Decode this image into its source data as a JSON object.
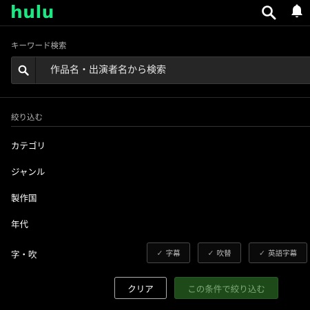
{
  "header": {
    "logo": "hulu",
    "icons": [
      "search-icon",
      "bell-icon"
    ]
  },
  "keyword": {
    "label": "キーワード検索",
    "placeholder": "作品名・出演者名から検索",
    "value": ""
  },
  "filter": {
    "label": "絞り込む",
    "rows": [
      "カテゴリ",
      "ジャンル",
      "製作国",
      "年代",
      "字・吹"
    ],
    "subtitle_options": [
      "字幕",
      "吹替",
      "英語字幕"
    ]
  },
  "actions": {
    "clear_label": "クリア",
    "apply_label": "この条件で絞り込む"
  },
  "colors": {
    "brand": "#1ce783",
    "background": "#000000",
    "input_bg": "#262626",
    "apply_bg": "#1e4a1a",
    "apply_text": "#7da878"
  }
}
